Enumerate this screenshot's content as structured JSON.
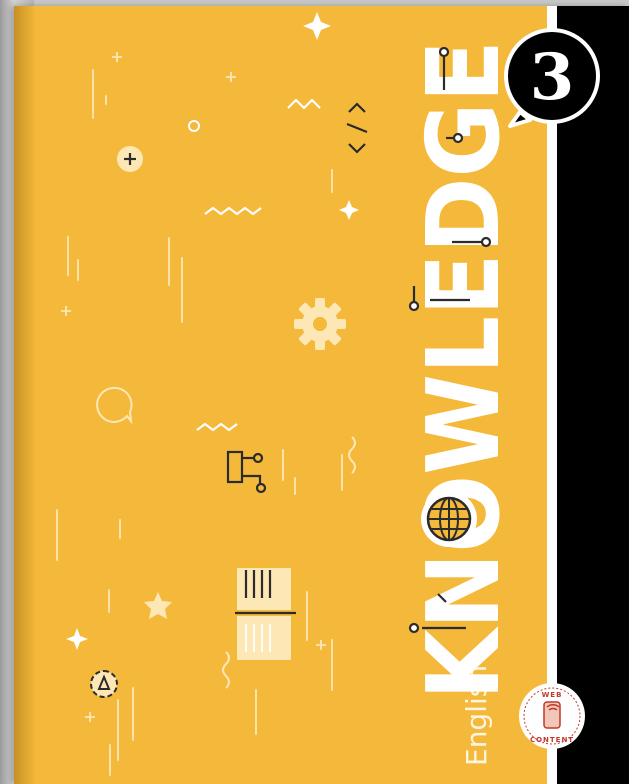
{
  "cover": {
    "title": "KNOWLEDGE",
    "number": "3",
    "subject": "English",
    "badge_top": "WEB",
    "badge_bottom": "CONTENT"
  },
  "colors": {
    "cover_yellow": "#f4b93a",
    "band_black": "#000000",
    "accent_white": "#ffffff",
    "ink_dark": "#2b2b2b",
    "decor_cream": "#fde7b5"
  },
  "icons": [
    "plus-icon",
    "code-tag-icon",
    "gear-icon",
    "chat-bubble-icon",
    "flowchart-icon",
    "star-icon",
    "sparkle-icon",
    "play-circle-icon",
    "globe-icon",
    "notebook-icon",
    "web-content-badge-icon"
  ]
}
